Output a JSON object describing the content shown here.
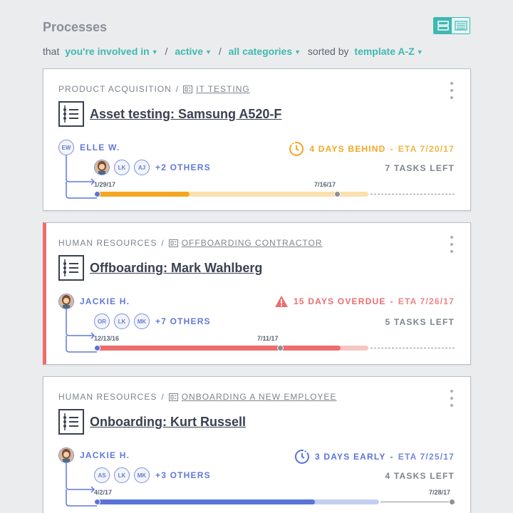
{
  "header": {
    "title": "Processes"
  },
  "filters": {
    "prefix": "that",
    "involvement": "you're involved in",
    "state": "active",
    "category": "all categories",
    "sort_label": "sorted by",
    "sort_value": "template A-Z"
  },
  "colors": {
    "accent": "#3fb8b0",
    "behind": "#f5a623",
    "overdue": "#ec6d6d",
    "early": "#5b73d9",
    "people": "#6178d9"
  },
  "cards": [
    {
      "category": "PRODUCT ACQUISITION",
      "template": "IT TESTING",
      "title": "Asset testing: Samsung A520-F",
      "owner": {
        "initials": "EW",
        "name": "ELLE W."
      },
      "status": {
        "icon": "clock-behind-icon",
        "text": "4 DAYS BEHIND",
        "eta": "ETA 7/20/17"
      },
      "others": [
        "AJ"
      ],
      "others_lead_photo": true,
      "others_initials": [
        "LK",
        "AJ"
      ],
      "others_more": "+2 OTHERS",
      "tasks_left": "7 TASKS LEFT",
      "timeline": {
        "start": "1/29/17",
        "marker": "7/16/17"
      }
    },
    {
      "category": "HUMAN RESOURCES",
      "template": "OFFBOARDING CONTRACTOR",
      "title": "Offboarding: Mark Wahlberg",
      "owner": {
        "initials": "JH",
        "name": "JACKIE H."
      },
      "status": {
        "icon": "warning-icon",
        "text": "15 DAYS OVERDUE",
        "eta": "ETA 7/26/17"
      },
      "others_initials": [
        "OR",
        "LK",
        "MK"
      ],
      "others_more": "+7 OTHERS",
      "tasks_left": "5 TASKS LEFT",
      "timeline": {
        "start": "12/13/16",
        "marker": "7/11/17"
      }
    },
    {
      "category": "HUMAN RESOURCES",
      "template": "ONBOARDING A NEW EMPLOYEE",
      "title": "Onboarding: Kurt Russell",
      "owner": {
        "initials": "JH",
        "name": "JACKIE H."
      },
      "status": {
        "icon": "clock-early-icon",
        "text": "3 DAYS EARLY",
        "eta": "ETA 7/25/17"
      },
      "others_initials": [
        "AS",
        "LK",
        "MK"
      ],
      "others_more": "+3 OTHERS",
      "tasks_left": "4 TASKS LEFT",
      "timeline": {
        "start": "4/2/17",
        "end": "7/28/17"
      }
    }
  ]
}
